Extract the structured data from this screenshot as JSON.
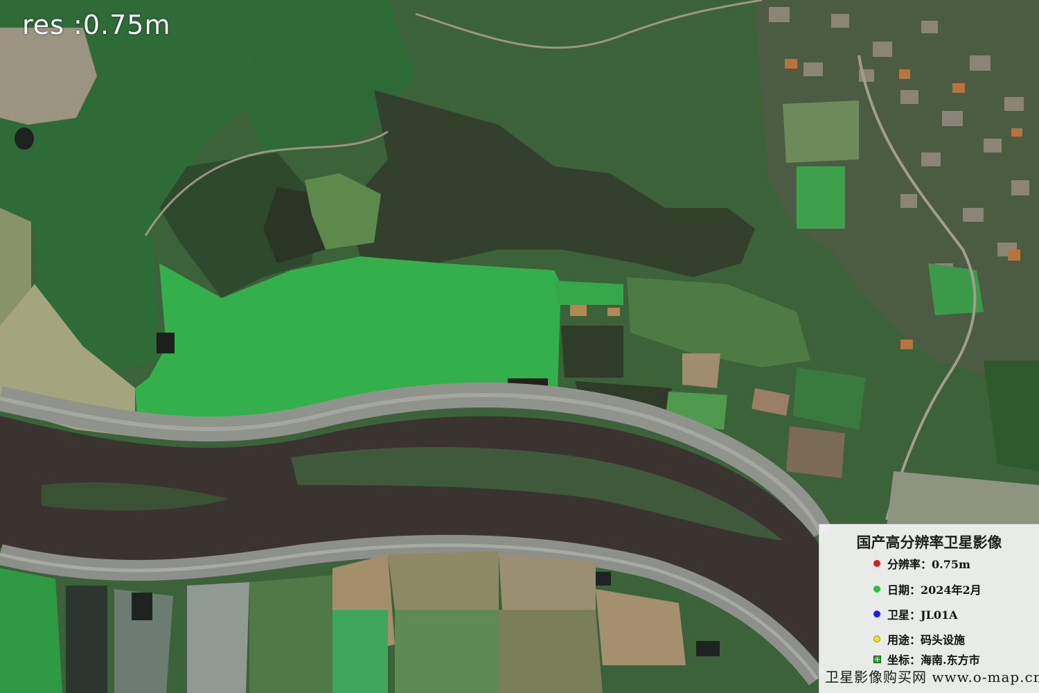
{
  "map": {
    "resolution_label": "res :0.75m",
    "legend": {
      "title": "国产高分辨率卫星影像",
      "items": [
        {
          "marker": "red-dot",
          "color": "#e0191e",
          "text": "分辨率：0.75m"
        },
        {
          "marker": "green-dot",
          "color": "#1fc92f",
          "text": "日期：2024年2月"
        },
        {
          "marker": "blue-dot",
          "color": "#1a1aff",
          "text": "卫星：JL01A"
        },
        {
          "marker": "yellow-dot",
          "color": "#f2e21a",
          "text": "用途：码头设施"
        },
        {
          "marker": "green-square-icon",
          "color": "#1fb02a",
          "text": "坐标：海南.东方市"
        }
      ],
      "footer": "卫星影像购买网 www.o-map.cn"
    },
    "colors": {
      "river": "#3a3430",
      "bright_field": "#2fb84c",
      "dark_field": "#2f3f2a",
      "crop_green": "#2f7a3a",
      "levee": "#8e9188"
    }
  }
}
